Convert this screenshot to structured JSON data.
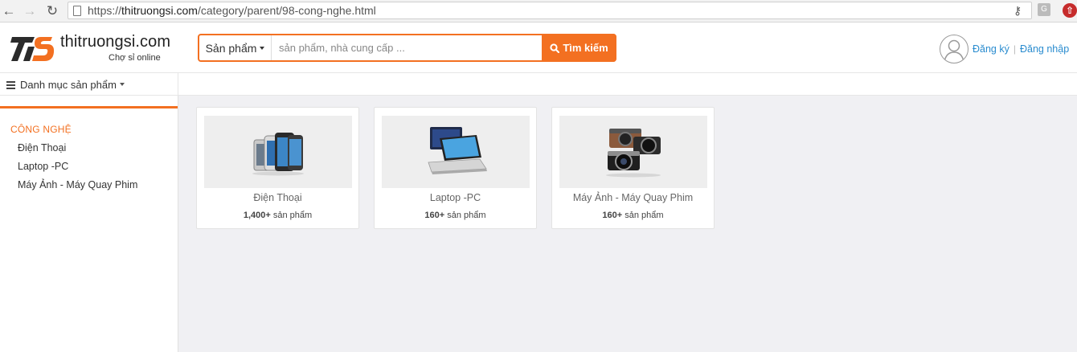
{
  "browser": {
    "url_scheme": "https://",
    "url_host": "thitruongsi.com",
    "url_path": "/category/parent/98-cong-nghe.html"
  },
  "header": {
    "brand": "thitruongsi.com",
    "tagline": "Chợ sỉ online",
    "search": {
      "scope_label": "Sản phẩm",
      "placeholder": "sản phẩm, nhà cung cấp ...",
      "button_label": "Tìm kiếm"
    },
    "auth": {
      "register_label": "Đăng ký",
      "login_label": "Đăng nhập"
    }
  },
  "catbar": {
    "label": "Danh mục sản phẩm"
  },
  "sidebar": {
    "section_title": "CÔNG NGHỆ",
    "items": [
      {
        "label": "Điện Thoại"
      },
      {
        "label": "Laptop -PC"
      },
      {
        "label": "Máy Ảnh - Máy Quay Phim"
      }
    ]
  },
  "cards": [
    {
      "title": "Điện Thoại",
      "count": "1,400+",
      "count_suffix": " sản phẩm"
    },
    {
      "title": "Laptop -PC",
      "count": "160+",
      "count_suffix": " sản phẩm"
    },
    {
      "title": "Máy Ảnh - Máy Quay Phim",
      "count": "160+",
      "count_suffix": " sản phẩm"
    }
  ],
  "colors": {
    "accent": "#f37021",
    "link": "#2a8ccf",
    "page_bg": "#f0f0f3"
  }
}
